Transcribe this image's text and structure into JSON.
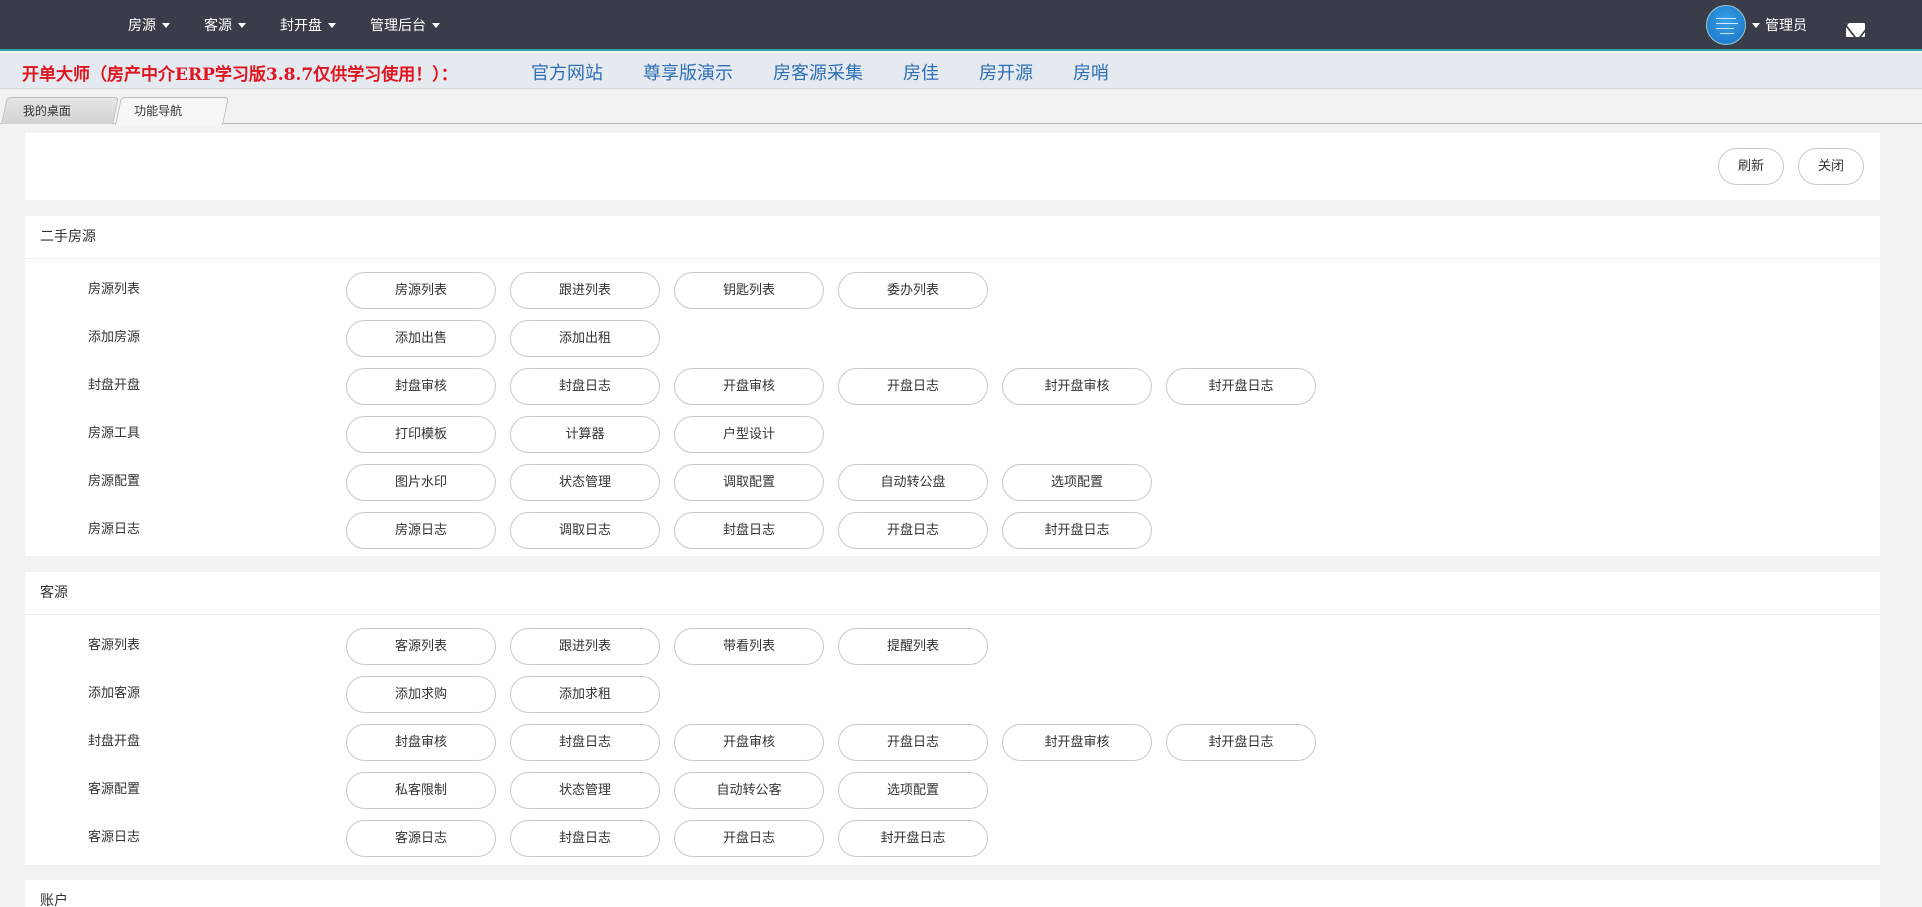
{
  "nav": {
    "menu": [
      "房源",
      "客源",
      "封开盘",
      "管理后台"
    ],
    "user": "管理员"
  },
  "banner": {
    "brand": "开单大师（房产中介ERP学习版3.8.7仅供学习使用！）：",
    "links": [
      "官方网站",
      "尊享版演示",
      "房客源采集",
      "房佳",
      "房开源",
      "房哨"
    ]
  },
  "tabs": {
    "desktop": "我的桌面",
    "nav": "功能导航",
    "close": "×"
  },
  "toolbar": {
    "refresh": "刷新",
    "close": "关闭"
  },
  "sections": [
    {
      "title": "二手房源",
      "rows": [
        {
          "label": "房源列表",
          "items": [
            "房源列表",
            "跟进列表",
            "钥匙列表",
            "委办列表"
          ]
        },
        {
          "label": "添加房源",
          "items": [
            "添加出售",
            "添加出租"
          ]
        },
        {
          "label": "封盘开盘",
          "items": [
            "封盘审核",
            "封盘日志",
            "开盘审核",
            "开盘日志",
            "封开盘审核",
            "封开盘日志"
          ]
        },
        {
          "label": "房源工具",
          "items": [
            "打印模板",
            "计算器",
            "户型设计"
          ]
        },
        {
          "label": "房源配置",
          "items": [
            "图片水印",
            "状态管理",
            "调取配置",
            "自动转公盘",
            "选项配置"
          ]
        },
        {
          "label": "房源日志",
          "items": [
            "房源日志",
            "调取日志",
            "封盘日志",
            "开盘日志",
            "封开盘日志"
          ]
        }
      ]
    },
    {
      "title": "客源",
      "rows": [
        {
          "label": "客源列表",
          "items": [
            "客源列表",
            "跟进列表",
            "带看列表",
            "提醒列表"
          ]
        },
        {
          "label": "添加客源",
          "items": [
            "添加求购",
            "添加求租"
          ]
        },
        {
          "label": "封盘开盘",
          "items": [
            "封盘审核",
            "封盘日志",
            "开盘审核",
            "开盘日志",
            "封开盘审核",
            "封开盘日志"
          ]
        },
        {
          "label": "客源配置",
          "items": [
            "私客限制",
            "状态管理",
            "自动转公客",
            "选项配置"
          ]
        },
        {
          "label": "客源日志",
          "items": [
            "客源日志",
            "封盘日志",
            "开盘日志",
            "封开盘日志"
          ]
        }
      ]
    },
    {
      "title": "账户",
      "rows": []
    }
  ]
}
